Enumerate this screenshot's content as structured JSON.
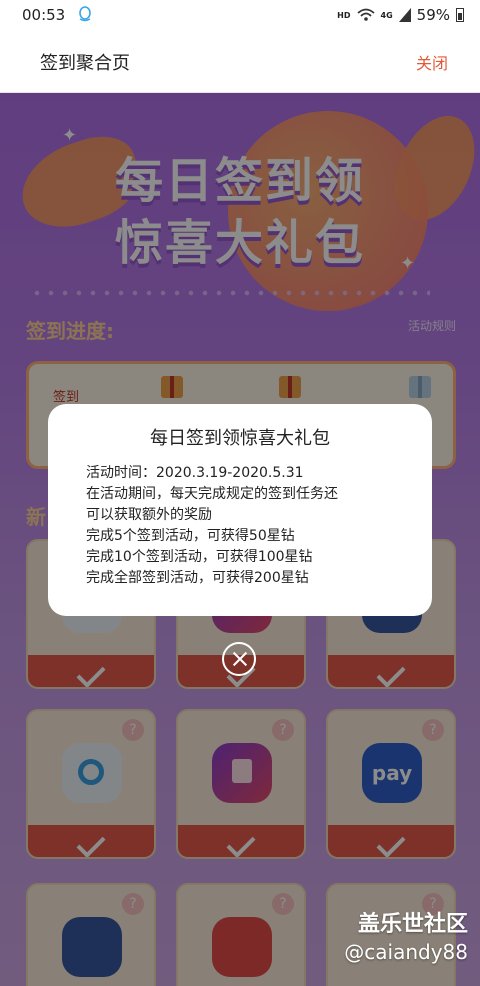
{
  "status_bar": {
    "time": "00:53",
    "network": "HD",
    "signal_label": "4G",
    "battery": "59%"
  },
  "header": {
    "title": "签到聚合页",
    "close_label": "关闭"
  },
  "banner": {
    "line1": "每日签到领",
    "line2": "惊喜大礼包"
  },
  "progress": {
    "title": "签到进度:",
    "rules_link": "活动规则",
    "card_label": "签到"
  },
  "section": {
    "title": "新"
  },
  "tiles": [
    {
      "icon": "bixby-vision-icon"
    },
    {
      "icon": "theme-brush-icon"
    },
    {
      "icon": "samsung-pay-icon",
      "text": "pay"
    },
    {
      "icon": "smartthings-home-icon"
    },
    {
      "icon": "book-reader-icon"
    }
  ],
  "modal": {
    "title": "每日签到领惊喜大礼包",
    "lines": [
      "活动时间：2020.3.19-2020.5.31",
      "在活动期间，每天完成规定的签到任务还",
      "可以获取额外的奖励",
      "完成5个签到活动，可获得50星钻",
      "完成10个签到活动，可获得100星钻",
      "完成全部签到活动，可获得200星钻"
    ]
  },
  "watermark": {
    "line1": "盖乐世社区",
    "line2": "@caiandy88"
  }
}
